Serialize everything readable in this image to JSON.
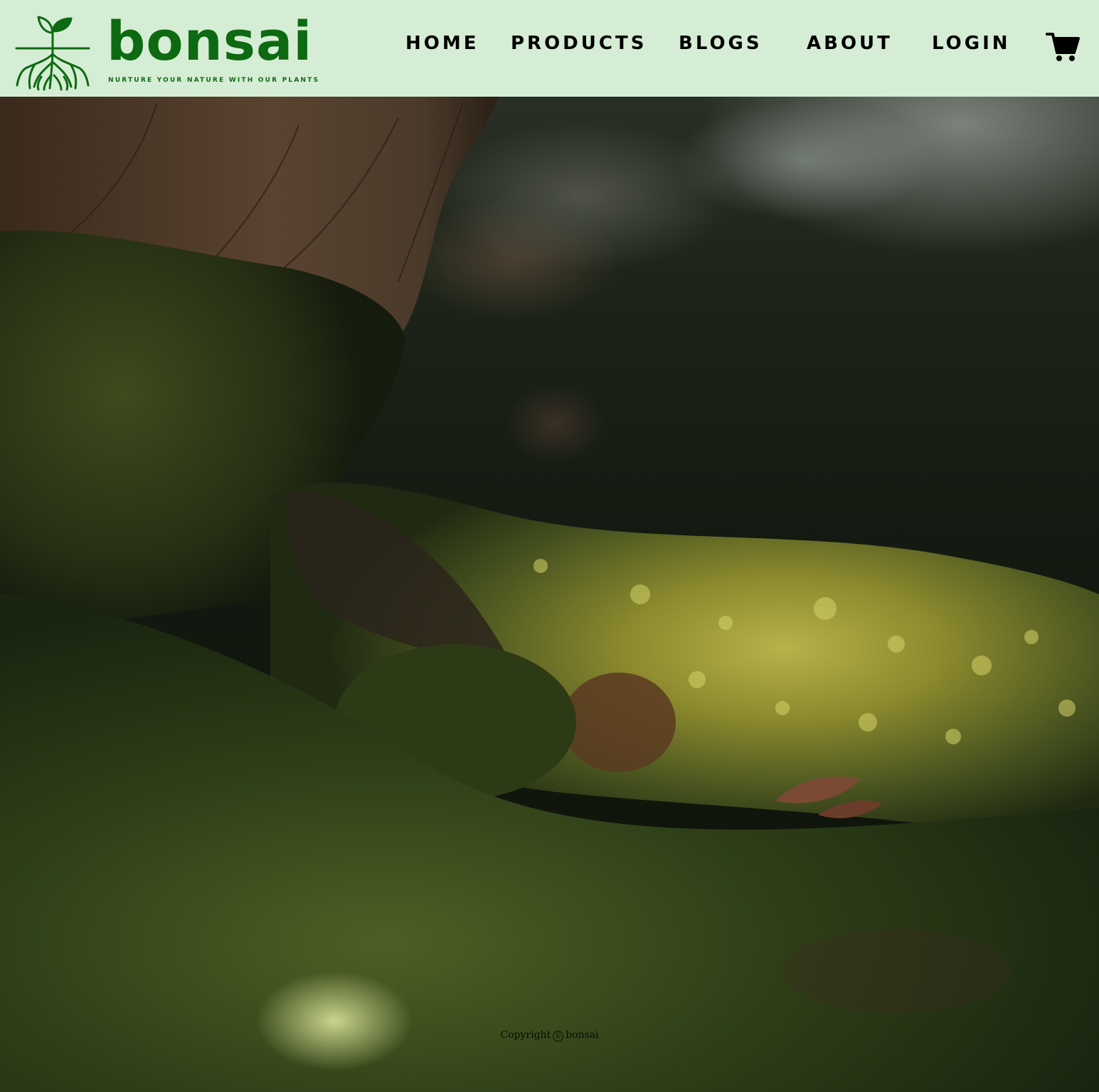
{
  "brand": {
    "name": "bonsai",
    "tagline": "NURTURE YOUR NATURE WITH OUR PLANTS",
    "color": "#0d6a12"
  },
  "header": {
    "background": "#d6edd5"
  },
  "nav": {
    "home": "HOME",
    "products": "PRODUCTS",
    "blogs": "BLOGS",
    "about": "ABOUT",
    "login": "LOGIN",
    "cart_icon": "shopping-cart-icon"
  },
  "hero": {
    "image_subject": "sunlit moss at the base of a tree trunk"
  },
  "footer": {
    "copyright_label": "Copyright",
    "copyright_symbol": "©",
    "copyright_owner": "bonsai"
  }
}
